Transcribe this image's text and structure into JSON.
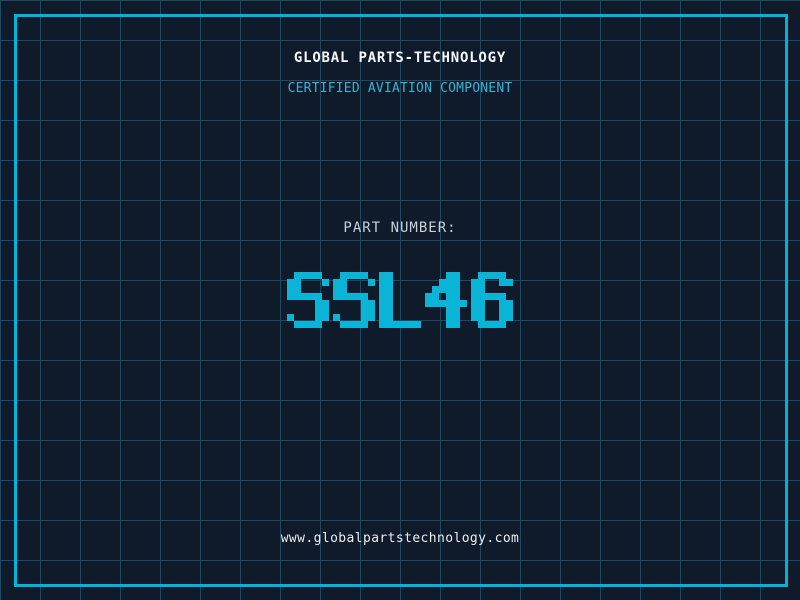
{
  "colors": {
    "background": "#0f1a2b",
    "grid_line": "#1b4a61",
    "frame_border": "#00b4d8",
    "header_text": "#f4f7fa",
    "certification_text": "#33b6d6",
    "part_label_text": "#c7d0da",
    "part_number_text": "#09b4d6",
    "url_text": "#e9eef3"
  },
  "header": {
    "company": "GLOBAL PARTS-TECHNOLOGY",
    "certification": "CERTIFIED AVIATION COMPONENT"
  },
  "part": {
    "label": "PART NUMBER:",
    "number": "SSL46"
  },
  "footer": {
    "url": "www.globalpartstechnology.com"
  }
}
